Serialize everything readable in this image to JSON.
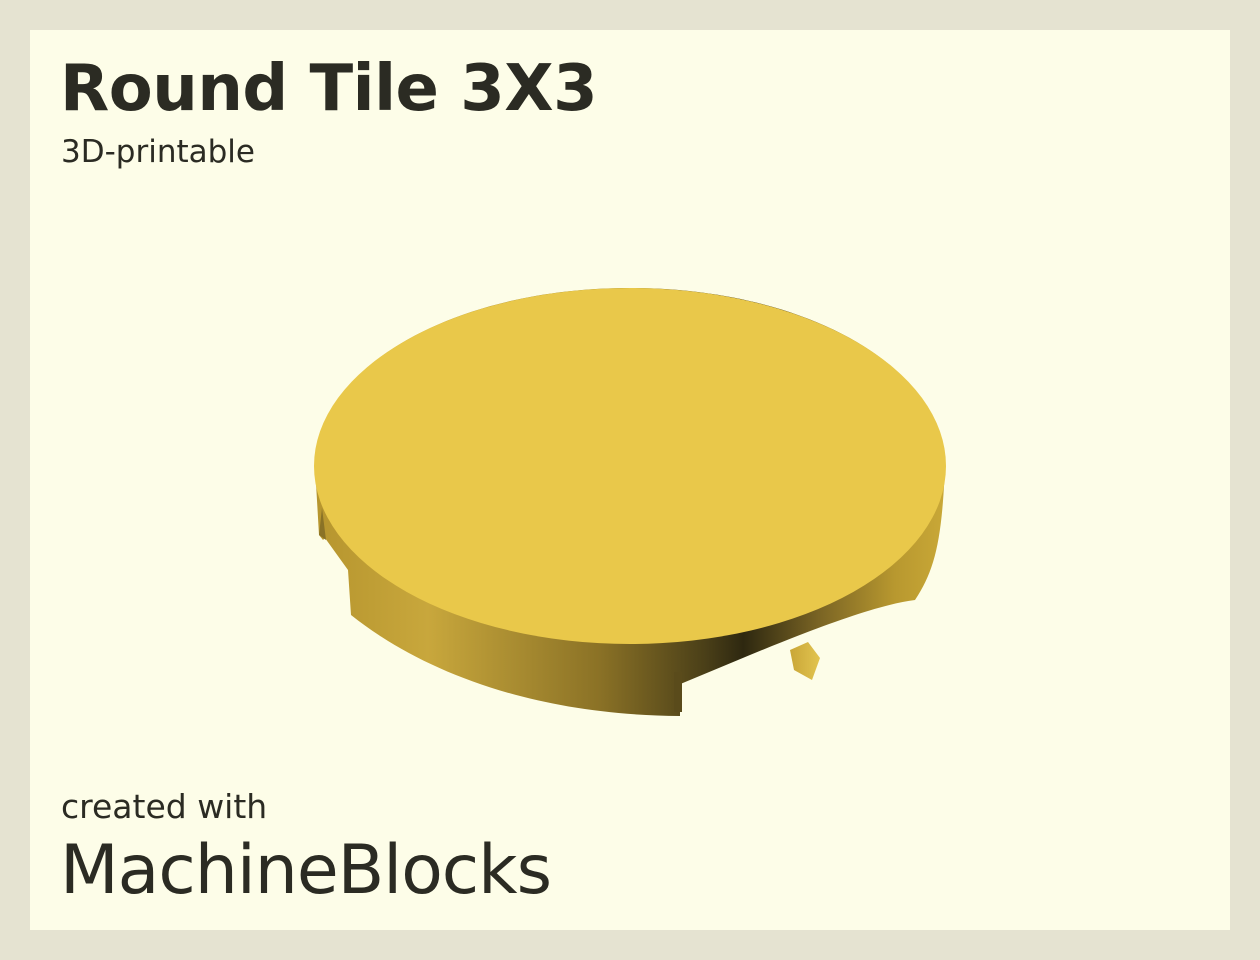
{
  "header": {
    "title": "Round Tile 3X3",
    "subtitle": "3D-printable"
  },
  "footer": {
    "credit_label": "created with",
    "brand": "MachineBlocks"
  },
  "model": {
    "top_color": "#e9c84a",
    "side_light_color": "#c9a63a",
    "side_dark_color": "#3a3116",
    "background_color": "#fdfde8",
    "frame_color": "#e5e3d1",
    "text_color": "#2b2b23"
  }
}
